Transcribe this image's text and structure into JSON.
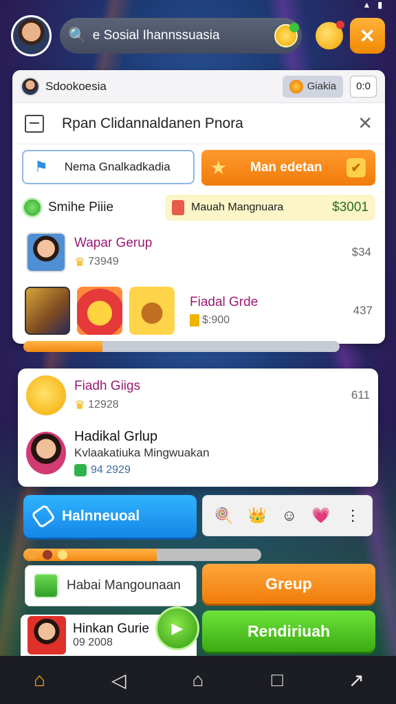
{
  "search": {
    "placeholder": "e Sosial Ihannssuasia"
  },
  "panel": {
    "header_title": "Sdookoesia",
    "chip_label": "Giakia",
    "counter": "0:0",
    "modal_title": "Rpan Clidannaldanen Pnora",
    "btn_outline": "Nema Gnalkadkadia",
    "btn_orange": "Man edetan",
    "info_label": "Smihe Piiie",
    "yellow_label": "Mauah Mangnuara",
    "yellow_amount": "$3001",
    "row1_title": "Wapar Gerup",
    "row1_sub": "73949",
    "row1_right": "$34",
    "row2_title": "Fiadal Grde",
    "row2_sub": "$:900",
    "row2_right": "437",
    "progress": 0.25
  },
  "card2": {
    "row1_title": "Fiadh Giigs",
    "row1_sub": "12928",
    "row1_right": "611",
    "row2_title": "Hadikal Grlup",
    "row2_sub": "Kvlaakatiuka Mingwuakan",
    "row2_amount": "94 2929"
  },
  "actions": {
    "blue_button": "Halnneuoal",
    "white_box": "Habai Mangounaan",
    "orange_button": "Greup",
    "green_button": "Rendiriuah",
    "bottom_title": "Hinkan Gurie",
    "bottom_sub": "09 2008",
    "progress": 0.56
  },
  "colors": {
    "accent_orange": "#f28a12",
    "accent_green": "#3aab12",
    "accent_blue": "#1686e6",
    "title_magenta": "#9a1a73"
  }
}
